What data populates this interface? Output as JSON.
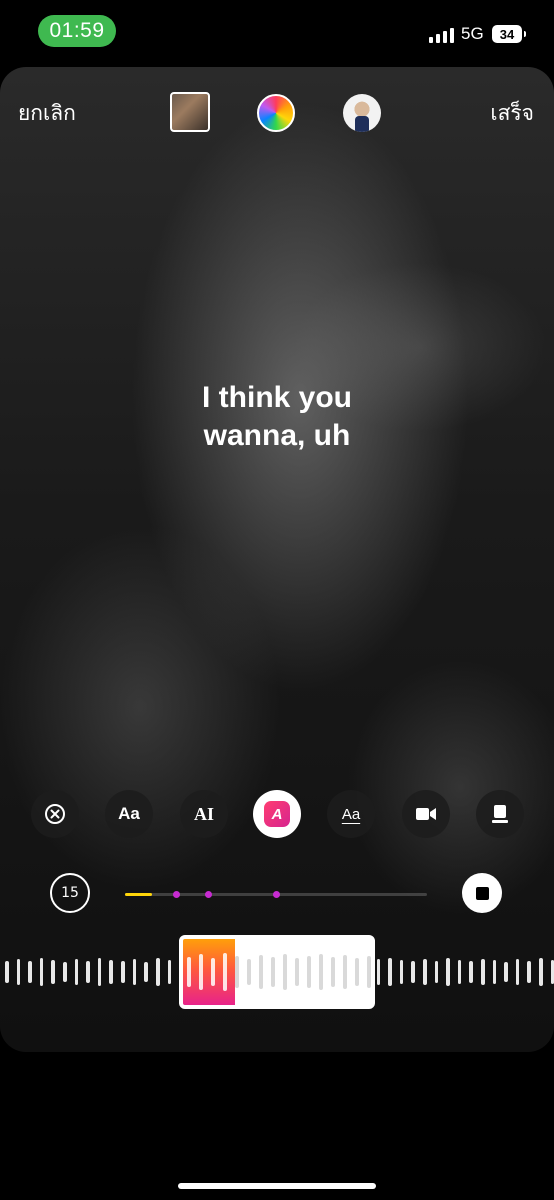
{
  "status_bar": {
    "time": "01:59",
    "network": "5G",
    "battery": "34"
  },
  "top_bar": {
    "cancel_label": "ยกเลิก",
    "done_label": "เสร็จ"
  },
  "lyrics": {
    "line1": "I think you",
    "line2": "wanna, uh"
  },
  "tools": [
    {
      "name": "remove",
      "icon": "close-circle-icon",
      "label": ""
    },
    {
      "name": "text-style",
      "icon": "text-aa-icon",
      "label": "Aa"
    },
    {
      "name": "font",
      "icon": "font-ai-icon",
      "label": "AI"
    },
    {
      "name": "color",
      "icon": "color-a-icon",
      "label": "A",
      "active": true
    },
    {
      "name": "underline",
      "icon": "underline-aa-icon",
      "label": "Aa"
    },
    {
      "name": "video",
      "icon": "video-icon",
      "label": ""
    },
    {
      "name": "card",
      "icon": "card-icon",
      "label": ""
    }
  ],
  "timeline": {
    "duration": "15",
    "progress": 0.09
  },
  "colors": {
    "accent_yellow": "#ffd60a",
    "marker_purple": "#c72bd1",
    "time_pill_green": "#3fb950",
    "selection_gradient_start": "#ff9f0a",
    "selection_gradient_end": "#e8238a"
  }
}
